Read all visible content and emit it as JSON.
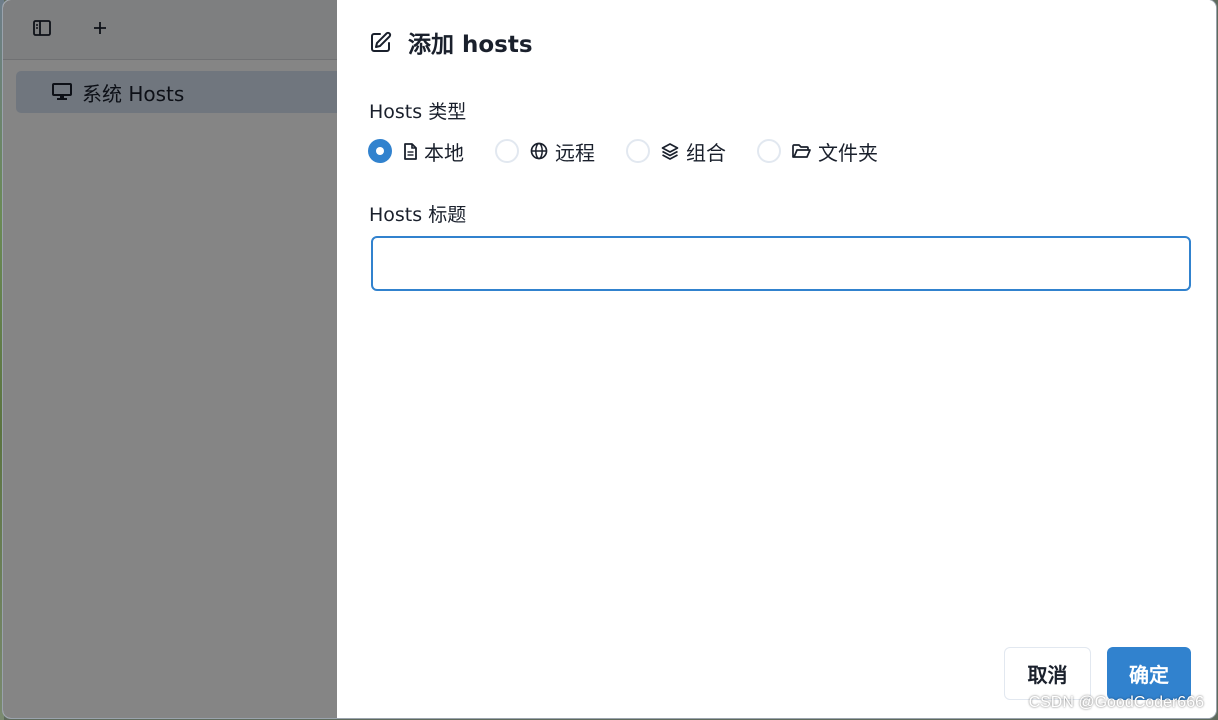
{
  "sidebar": {
    "toolbar": {
      "toggle_icon": "sidebar-panel-icon",
      "add_icon": "plus-icon",
      "add_label": "+"
    },
    "items": [
      {
        "icon": "monitor-icon",
        "label": "系统 Hosts",
        "selected": true
      }
    ]
  },
  "drawer": {
    "header": {
      "icon": "edit-icon",
      "title": "添加 hosts"
    },
    "type_field": {
      "label": "Hosts 类型",
      "options": [
        {
          "icon": "file-icon",
          "label": "本地",
          "checked": true
        },
        {
          "icon": "globe-icon",
          "label": "远程",
          "checked": false
        },
        {
          "icon": "layers-icon",
          "label": "组合",
          "checked": false
        },
        {
          "icon": "folder-icon",
          "label": "文件夹",
          "checked": false
        }
      ]
    },
    "title_field": {
      "label": "Hosts 标题",
      "value": ""
    },
    "footer": {
      "cancel_label": "取消",
      "ok_label": "确定"
    }
  },
  "watermark": "CSDN @GoodCoder666",
  "colors": {
    "accent": "#3182ce",
    "selected_item_bg": "#d6e2f2",
    "overlay": "rgba(0,0,0,0.48)",
    "text": "#1a202c"
  }
}
